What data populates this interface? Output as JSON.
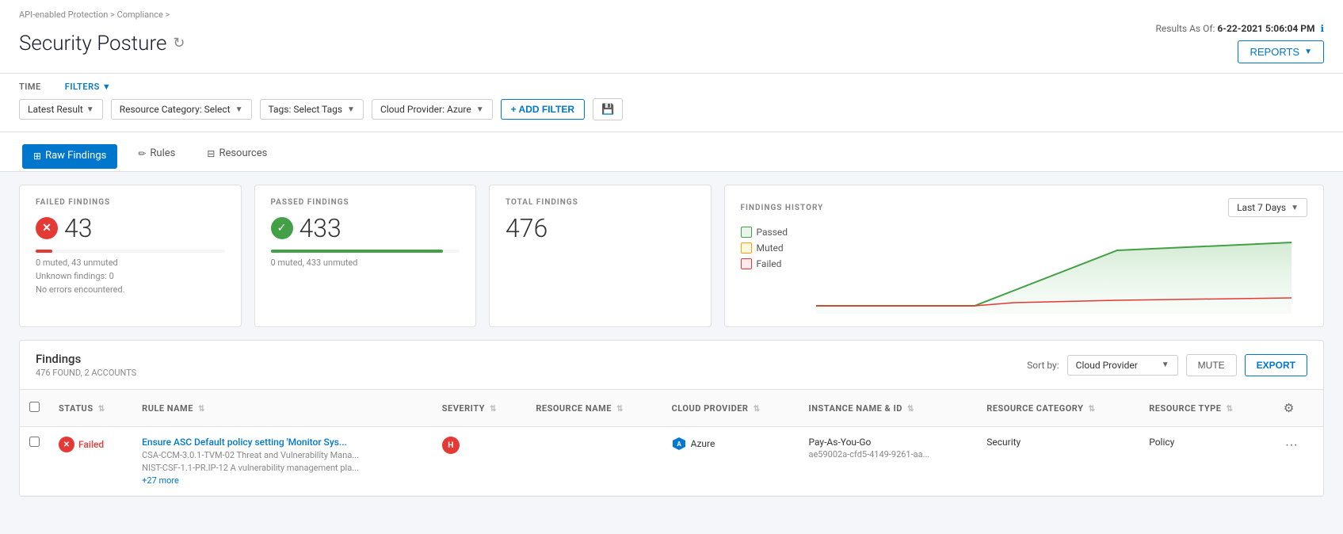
{
  "breadcrumb": {
    "items": [
      "API-enabled Protection",
      "Compliance",
      ""
    ]
  },
  "page": {
    "title": "Security Posture",
    "results_as_of": "Results As Of:",
    "timestamp": "6-22-2021 5:06:04 PM"
  },
  "toolbar": {
    "reports_label": "REPORTS"
  },
  "filters": {
    "time_label": "TIME",
    "filters_label": "FILTERS",
    "latest_result": "Latest Result",
    "resource_category": "Resource Category: Select",
    "tags": "Tags: Select Tags",
    "cloud_provider": "Cloud Provider: Azure",
    "add_filter": "+ ADD FILTER"
  },
  "tabs": [
    {
      "id": "raw-findings",
      "label": "Raw Findings",
      "active": true
    },
    {
      "id": "rules",
      "label": "Rules",
      "active": false
    },
    {
      "id": "resources",
      "label": "Resources",
      "active": false
    }
  ],
  "stats": {
    "failed": {
      "label": "FAILED FINDINGS",
      "count": "43",
      "sub": "0 muted, 43 unmuted",
      "extra1": "Unknown findings: 0",
      "extra2": "No errors encountered."
    },
    "passed": {
      "label": "PASSED FINDINGS",
      "count": "433",
      "sub": "0 muted, 433 unmuted"
    },
    "total": {
      "label": "TOTAL FINDINGS",
      "count": "476"
    }
  },
  "history": {
    "label": "FINDINGS HISTORY",
    "period": "Last 7 Days",
    "legend": {
      "passed": "Passed",
      "muted": "Muted",
      "failed": "Failed"
    }
  },
  "findings_table": {
    "title": "Findings",
    "count_label": "476 FOUND, 2 ACCOUNTS",
    "sort_by": "Sort by:",
    "sort_value": "Cloud Provider",
    "mute_btn": "MUTE",
    "export_btn": "EXPORT",
    "columns": {
      "status": "STATUS",
      "rule_name": "RULE NAME",
      "severity": "SEVERITY",
      "resource_name": "RESOURCE NAME",
      "cloud_provider": "CLOUD PROVIDER",
      "instance_name": "INSTANCE NAME & ID",
      "resource_category": "RESOURCE CATEGORY",
      "resource_type": "RESOURCE TYPE"
    },
    "rows": [
      {
        "status": "Failed",
        "rule_name": "Ensure ASC Default policy setting 'Monitor Sys...",
        "rule_sub1": "CSA-CCM-3.0.1-TVM-02 Threat and Vulnerability Mana...",
        "rule_sub2": "NIST-CSF-1.1-PR.IP-12 A vulnerability management pla...",
        "rule_sub3": "+27 more",
        "severity": "H",
        "resource_name": "",
        "cloud_provider": "Azure",
        "instance_name": "Pay-As-You-Go",
        "instance_id": "ae59002a-cfd5-4149-9261-aa...",
        "resource_category": "Security",
        "resource_type": "Policy"
      }
    ]
  }
}
